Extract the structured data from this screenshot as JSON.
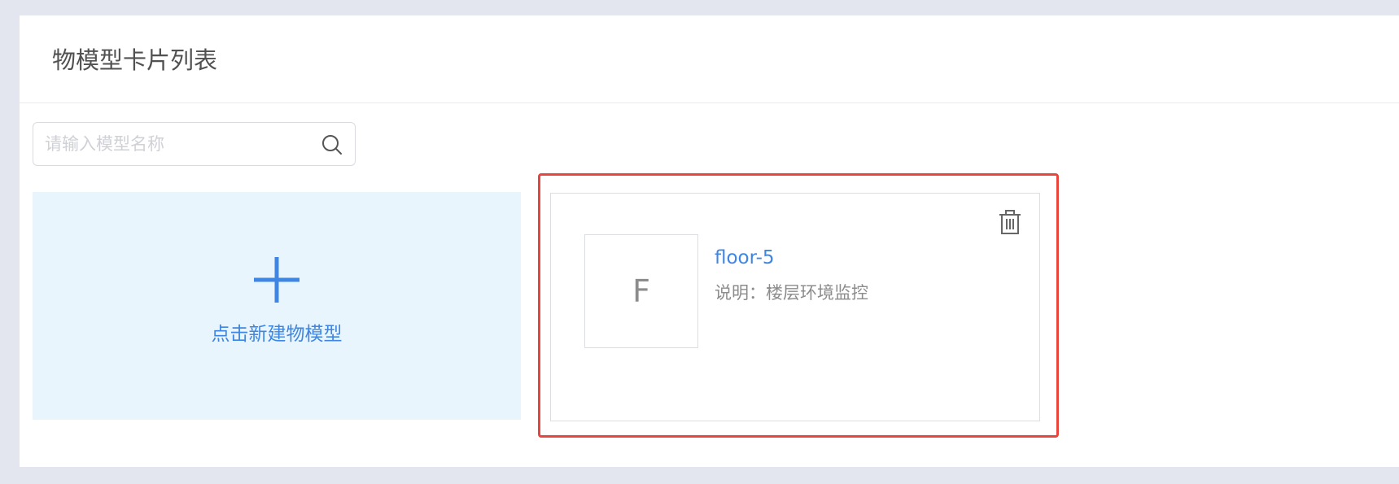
{
  "header": {
    "title": "物模型卡片列表"
  },
  "search": {
    "placeholder": "请输入模型名称",
    "icon": "search-icon"
  },
  "add_card": {
    "label": "点击新建物模型",
    "icon": "plus-icon"
  },
  "model_cards": [
    {
      "avatar_letter": "F",
      "name": "floor-5",
      "description": "说明：楼层环境监控",
      "delete_icon": "trash-icon"
    }
  ],
  "colors": {
    "background": "#e3e6ee",
    "accent": "#3e86e2",
    "add_card_bg": "#e9f5fc",
    "highlight_border": "#e8453c",
    "muted_text": "#8c8c8c"
  }
}
